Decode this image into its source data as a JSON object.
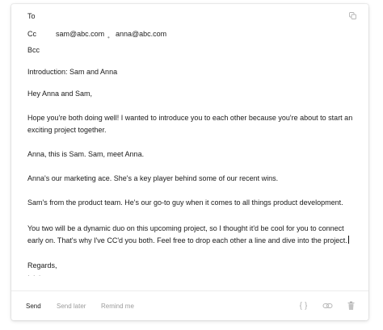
{
  "header": {
    "to_label": "To",
    "cc_label": "Cc",
    "bcc_label": "Bcc",
    "cc_recipients": [
      "sam@abc.com",
      "anna@abc.com"
    ],
    "cc_separator": "•"
  },
  "subject": "Introduction: Sam and Anna",
  "body": {
    "greeting": "Hey Anna and Sam,",
    "paragraph1_line1": "Hope you're both doing well! I wanted to introduce you to each other because you're about to start an",
    "paragraph1_line2": "exciting project together.",
    "paragraph2": "Anna, this is Sam. Sam, meet Anna.",
    "paragraph3": "Anna's our marketing ace.  She's a key player behind some of our recent wins.",
    "paragraph4": "Sam's from the product team. He's our go-to guy when it comes to all things product development.",
    "paragraph5_line1": "You two will be a dynamic duo on this upcoming project, so I thought it'd be cool for you to connect",
    "paragraph5_line2": "early on. That's why I've CC'd you both. Feel free to drop each other a line and dive into the project.",
    "closing": "Regards,",
    "signature_placeholder": "· · ·"
  },
  "footer": {
    "send_label": "Send",
    "send_later_label": "Send later",
    "remind_me_label": "Remind me"
  },
  "icons": {
    "copy": "copy-icon",
    "variables": "curly-braces-icon",
    "link": "link-icon",
    "delete": "trash-icon"
  },
  "colors": {
    "text_primary": "#1a1a1a",
    "text_muted": "#9b9b9b",
    "icon_gray": "#b5b5b5"
  }
}
